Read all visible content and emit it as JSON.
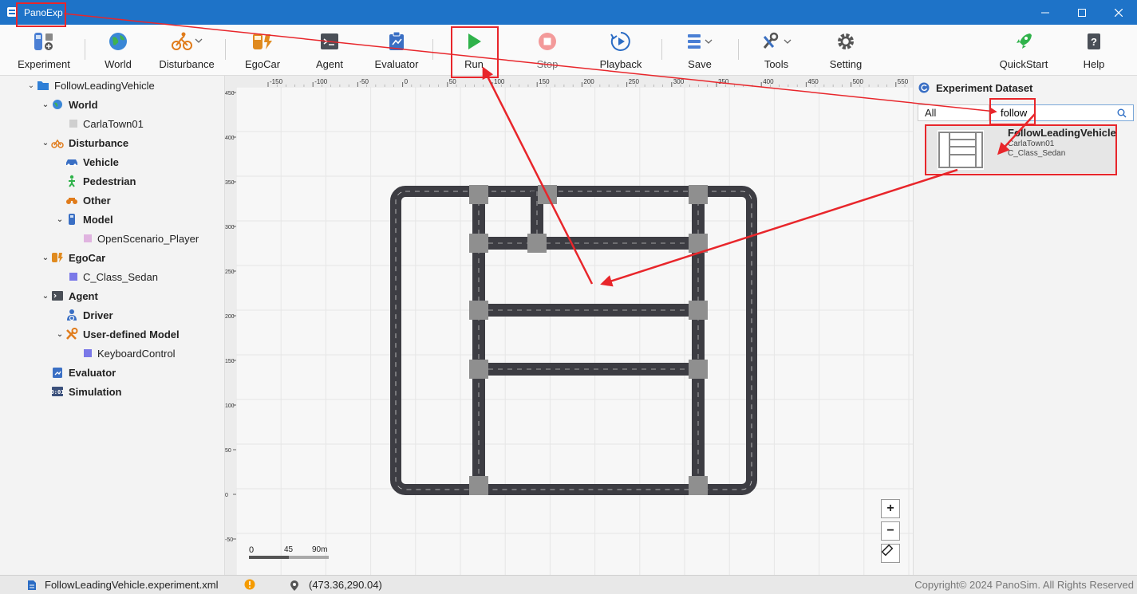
{
  "window": {
    "title": "PanoExp",
    "controls": [
      "minimize",
      "maximize",
      "close"
    ]
  },
  "toolbar": {
    "items": [
      {
        "label": "Experiment",
        "icon": "experiment-icon"
      },
      {
        "label": "World",
        "icon": "globe-icon"
      },
      {
        "label": "Disturbance",
        "icon": "disturbance-icon"
      },
      {
        "label": "EgoCar",
        "icon": "egocar-icon"
      },
      {
        "label": "Agent",
        "icon": "agent-icon"
      },
      {
        "label": "Evaluator",
        "icon": "evaluator-icon"
      },
      {
        "label": "Run",
        "icon": "play-icon"
      },
      {
        "label": "Stop",
        "icon": "stop-icon"
      },
      {
        "label": "Playback",
        "icon": "playback-icon"
      },
      {
        "label": "Save",
        "icon": "save-icon"
      },
      {
        "label": "Tools",
        "icon": "tools-icon"
      },
      {
        "label": "Setting",
        "icon": "gear-icon"
      },
      {
        "label": "QuickStart",
        "icon": "rocket-icon"
      },
      {
        "label": "Help",
        "icon": "help-icon"
      }
    ]
  },
  "tree": {
    "root": "FollowLeadingVehicle",
    "nodes": [
      {
        "label": "World"
      },
      {
        "label": "CarlaTown01"
      },
      {
        "label": "Disturbance"
      },
      {
        "label": "Vehicle"
      },
      {
        "label": "Pedestrian"
      },
      {
        "label": "Other"
      },
      {
        "label": "Model"
      },
      {
        "label": "OpenScenario_Player"
      },
      {
        "label": "EgoCar"
      },
      {
        "label": "C_Class_Sedan"
      },
      {
        "label": "Agent"
      },
      {
        "label": "Driver"
      },
      {
        "label": "User-defined Model"
      },
      {
        "label": "KeyboardControl"
      },
      {
        "label": "Evaluator"
      },
      {
        "label": "Simulation"
      }
    ]
  },
  "canvas": {
    "x_ticks": [
      "-150",
      "-100",
      "-50",
      "0",
      "50",
      "100",
      "150",
      "200",
      "250",
      "300",
      "350",
      "400",
      "450",
      "500",
      "550"
    ],
    "y_ticks": [
      "450",
      "400",
      "350",
      "300",
      "250",
      "200",
      "150",
      "100",
      "50",
      "0",
      "-50"
    ],
    "scale_labels": [
      "0",
      "45",
      "90m"
    ],
    "zoom_in": "+",
    "zoom_out": "−"
  },
  "dataset": {
    "title": "Experiment Dataset",
    "filter": "All",
    "search_value": "follow",
    "card": {
      "title": "FollowLeadingVehicle",
      "map": "CarlaTown01",
      "vehicle": "C_Class_Sedan"
    }
  },
  "status": {
    "file": "FollowLeadingVehicle.experiment.xml",
    "coords": "(473.36,290.04)",
    "copyright": "Copyright© 2024 PanoSim. All Rights Reserved"
  },
  "colors": {
    "titlebar": "#1e73c8",
    "annotation": "#e8262b",
    "road": "#3d3d43"
  }
}
